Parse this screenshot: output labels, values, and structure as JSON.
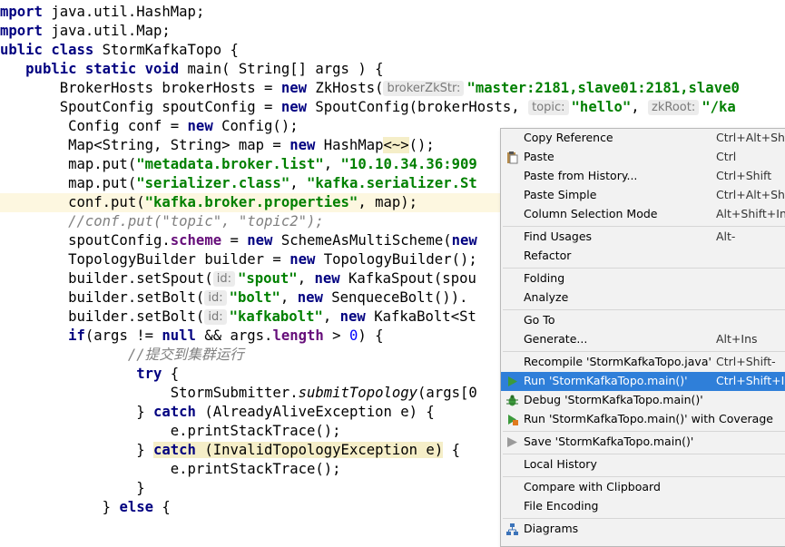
{
  "editor": {
    "lines": [
      [
        {
          "t": "mport",
          "c": "kw"
        },
        {
          "t": " java.util.HashMap;"
        }
      ],
      [
        {
          "t": "mport",
          "c": "kw"
        },
        {
          "t": " java.util.Map;"
        }
      ],
      [
        {
          "t": "ublic class",
          "c": "kw"
        },
        {
          "t": " StormKafkaTopo {"
        }
      ],
      [
        {
          "t": "   "
        },
        {
          "t": "public static void",
          "c": "kw"
        },
        {
          "t": " main( String[] args ) {"
        }
      ],
      [
        {
          "t": "       BrokerHosts brokerHosts = "
        },
        {
          "t": "new",
          "c": "kw"
        },
        {
          "t": " ZkHosts("
        },
        {
          "t": "brokerZkStr:",
          "c": "hint"
        },
        {
          "t": "\"master:2181,slave01:2181,slave0",
          "c": "str"
        }
      ],
      [
        {
          "t": "       SpoutConfig spoutConfig = "
        },
        {
          "t": "new",
          "c": "kw"
        },
        {
          "t": " SpoutConfig(brokerHosts, "
        },
        {
          "t": "topic:",
          "c": "hint"
        },
        {
          "t": "\"hello\"",
          "c": "str"
        },
        {
          "t": ", "
        },
        {
          "t": "zkRoot:",
          "c": "hint"
        },
        {
          "t": "\"/ka",
          "c": "str"
        }
      ],
      [
        {
          "t": "        Config conf = "
        },
        {
          "t": "new",
          "c": "kw"
        },
        {
          "t": " Config();"
        }
      ],
      [
        {
          "t": "        Map<String, String> map = "
        },
        {
          "t": "new",
          "c": "kw"
        },
        {
          "t": " HashMap"
        },
        {
          "t": "<~>",
          "c": "mark"
        },
        {
          "t": "();"
        }
      ],
      [
        {
          "t": "        map.put("
        },
        {
          "t": "\"metadata.broker.list\"",
          "c": "str"
        },
        {
          "t": ", "
        },
        {
          "t": "\"10.10.34.36:909",
          "c": "str"
        }
      ],
      [
        {
          "t": "        map.put("
        },
        {
          "t": "\"serializer.class\"",
          "c": "str"
        },
        {
          "t": ", "
        },
        {
          "t": "\"kafka.serializer.St",
          "c": "str"
        }
      ],
      [
        {
          "t": "        conf.put("
        },
        {
          "t": "\"kafka.broker.properties\"",
          "c": "str"
        },
        {
          "t": ", map);"
        }
      ],
      [
        {
          "t": "        "
        },
        {
          "t": "//conf.put(\"topic\", \"topic2\");",
          "c": "com"
        }
      ],
      [
        {
          "t": "        spoutConfig."
        },
        {
          "t": "scheme",
          "c": "fld"
        },
        {
          "t": " = "
        },
        {
          "t": "new",
          "c": "kw"
        },
        {
          "t": " SchemeAsMultiScheme("
        },
        {
          "t": "new",
          "c": "kw"
        }
      ],
      [
        {
          "t": "        TopologyBuilder builder = "
        },
        {
          "t": "new",
          "c": "kw"
        },
        {
          "t": " TopologyBuilder();"
        }
      ],
      [
        {
          "t": "        builder.setSpout("
        },
        {
          "t": "id:",
          "c": "hint"
        },
        {
          "t": "\"spout\"",
          "c": "str"
        },
        {
          "t": ", "
        },
        {
          "t": "new",
          "c": "kw"
        },
        {
          "t": " KafkaSpout(spou"
        }
      ],
      [
        {
          "t": "        builder.setBolt("
        },
        {
          "t": "id:",
          "c": "hint"
        },
        {
          "t": "\"bolt\"",
          "c": "str"
        },
        {
          "t": ", "
        },
        {
          "t": "new",
          "c": "kw"
        },
        {
          "t": " SenqueceBolt())."
        }
      ],
      [
        {
          "t": "        builder.setBolt("
        },
        {
          "t": "id:",
          "c": "hint"
        },
        {
          "t": "\"kafkabolt\"",
          "c": "str"
        },
        {
          "t": ", "
        },
        {
          "t": "new",
          "c": "kw"
        },
        {
          "t": " KafkaBolt<St"
        }
      ],
      [
        {
          "t": "        "
        },
        {
          "t": "if",
          "c": "kw"
        },
        {
          "t": "(args != "
        },
        {
          "t": "null",
          "c": "kw"
        },
        {
          "t": " && args."
        },
        {
          "t": "length",
          "c": "fld"
        },
        {
          "t": " > "
        },
        {
          "t": "0",
          "c": "num"
        },
        {
          "t": ") {"
        }
      ],
      [
        {
          "t": "               "
        },
        {
          "t": "//提交到集群运行",
          "c": "com"
        }
      ],
      [
        {
          "t": "                "
        },
        {
          "t": "try",
          "c": "kw"
        },
        {
          "t": " {"
        }
      ],
      [
        {
          "t": "                    StormSubmitter."
        },
        {
          "t": "submitTopology",
          "c": "stat"
        },
        {
          "t": "(args[0"
        }
      ],
      [
        {
          "t": "                } "
        },
        {
          "t": "catch",
          "c": "kw"
        },
        {
          "t": " (AlreadyAliveException e) {"
        }
      ],
      [
        {
          "t": "                    e.printStackTrace();"
        }
      ],
      [
        {
          "t": "                } "
        },
        {
          "t": "catch",
          "c": "kw brk"
        },
        {
          "t": " (InvalidTopologyException e)",
          "c": "brk"
        },
        {
          "t": " {"
        }
      ],
      [
        {
          "t": "                    e.printStackTrace();"
        }
      ],
      [
        {
          "t": "                }"
        }
      ],
      [
        {
          "t": "            } "
        },
        {
          "t": "else",
          "c": "kw"
        },
        {
          "t": " {"
        }
      ]
    ]
  },
  "context_menu": {
    "items": [
      {
        "label": "Copy Reference",
        "shortcut": "Ctrl+Alt+Shift"
      },
      {
        "label": "Paste",
        "shortcut": "Ctrl",
        "icon": "clipboard-icon"
      },
      {
        "label": "Paste from History...",
        "shortcut": "Ctrl+Shift"
      },
      {
        "label": "Paste Simple",
        "shortcut": "Ctrl+Alt+Shift"
      },
      {
        "label": "Column Selection Mode",
        "shortcut": "Alt+Shift+Ins"
      },
      {
        "sep": true
      },
      {
        "label": "Find Usages",
        "shortcut": "Alt-"
      },
      {
        "label": "Refactor",
        "shortcut": ""
      },
      {
        "sep": true
      },
      {
        "label": "Folding",
        "shortcut": ""
      },
      {
        "label": "Analyze",
        "shortcut": ""
      },
      {
        "sep": true
      },
      {
        "label": "Go To",
        "shortcut": ""
      },
      {
        "label": "Generate...",
        "shortcut": "Alt+Ins"
      },
      {
        "sep": true
      },
      {
        "label": "Recompile 'StormKafkaTopo.java'",
        "shortcut": "Ctrl+Shift-"
      },
      {
        "label": "Run 'StormKafkaTopo.main()'",
        "shortcut": "Ctrl+Shift+I",
        "icon": "run-icon",
        "selected": true
      },
      {
        "label": "Debug 'StormKafkaTopo.main()'",
        "shortcut": "",
        "icon": "debug-icon"
      },
      {
        "label": "Run 'StormKafkaTopo.main()' with Coverage",
        "shortcut": "",
        "icon": "coverage-icon"
      },
      {
        "sep": true
      },
      {
        "label": "Save 'StormKafkaTopo.main()'",
        "shortcut": "",
        "icon": "save-config-icon"
      },
      {
        "sep": true
      },
      {
        "label": "Local History",
        "shortcut": ""
      },
      {
        "sep": true
      },
      {
        "label": "Compare with Clipboard",
        "shortcut": ""
      },
      {
        "label": "File Encoding",
        "shortcut": ""
      },
      {
        "sep": true
      },
      {
        "label": "Diagrams",
        "shortcut": "",
        "icon": "diagram-icon"
      }
    ]
  },
  "colors": {
    "selection": "#2f7fd9",
    "run_green": "#3c9a3c"
  }
}
